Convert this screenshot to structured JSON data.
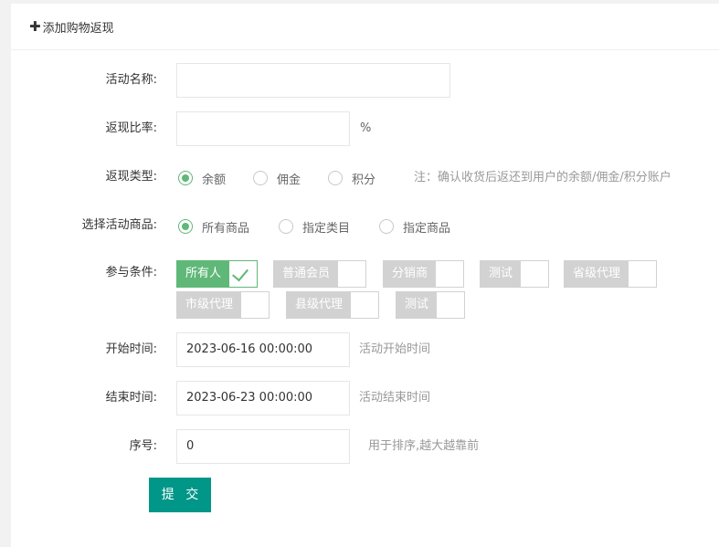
{
  "header": {
    "icon": "plus-icon",
    "title": "添加购物返现"
  },
  "form": {
    "name": {
      "label": "活动名称:",
      "value": ""
    },
    "rate": {
      "label": "返现比率:",
      "value": "",
      "unit": "%"
    },
    "type": {
      "label": "返现类型:",
      "options": [
        "余额",
        "佣金",
        "积分"
      ],
      "selected": "余额",
      "note": "注：确认收货后返还到用户的余额/佣金/积分账户"
    },
    "goods": {
      "label": "选择活动商品:",
      "options": [
        "所有商品",
        "指定类目",
        "指定商品"
      ],
      "selected": "所有商品"
    },
    "conditions": {
      "label": "参与条件:",
      "tags": [
        "所有人",
        "普通会员",
        "分销商",
        "测试",
        "省级代理",
        "市级代理",
        "县级代理",
        "测试"
      ],
      "checked": [
        "所有人"
      ]
    },
    "start": {
      "label": "开始时间:",
      "value": "2023-06-16 00:00:00",
      "hint": "活动开始时间"
    },
    "end": {
      "label": "结束时间:",
      "value": "2023-06-23 00:00:00",
      "hint": "活动结束时间"
    },
    "order": {
      "label": "序号:",
      "value": "0",
      "hint": "用于排序,越大越靠前"
    },
    "submit": "提 交"
  },
  "colors": {
    "accent": "#5FB878",
    "button": "#009688",
    "tag_off": "#d2d2d2"
  }
}
